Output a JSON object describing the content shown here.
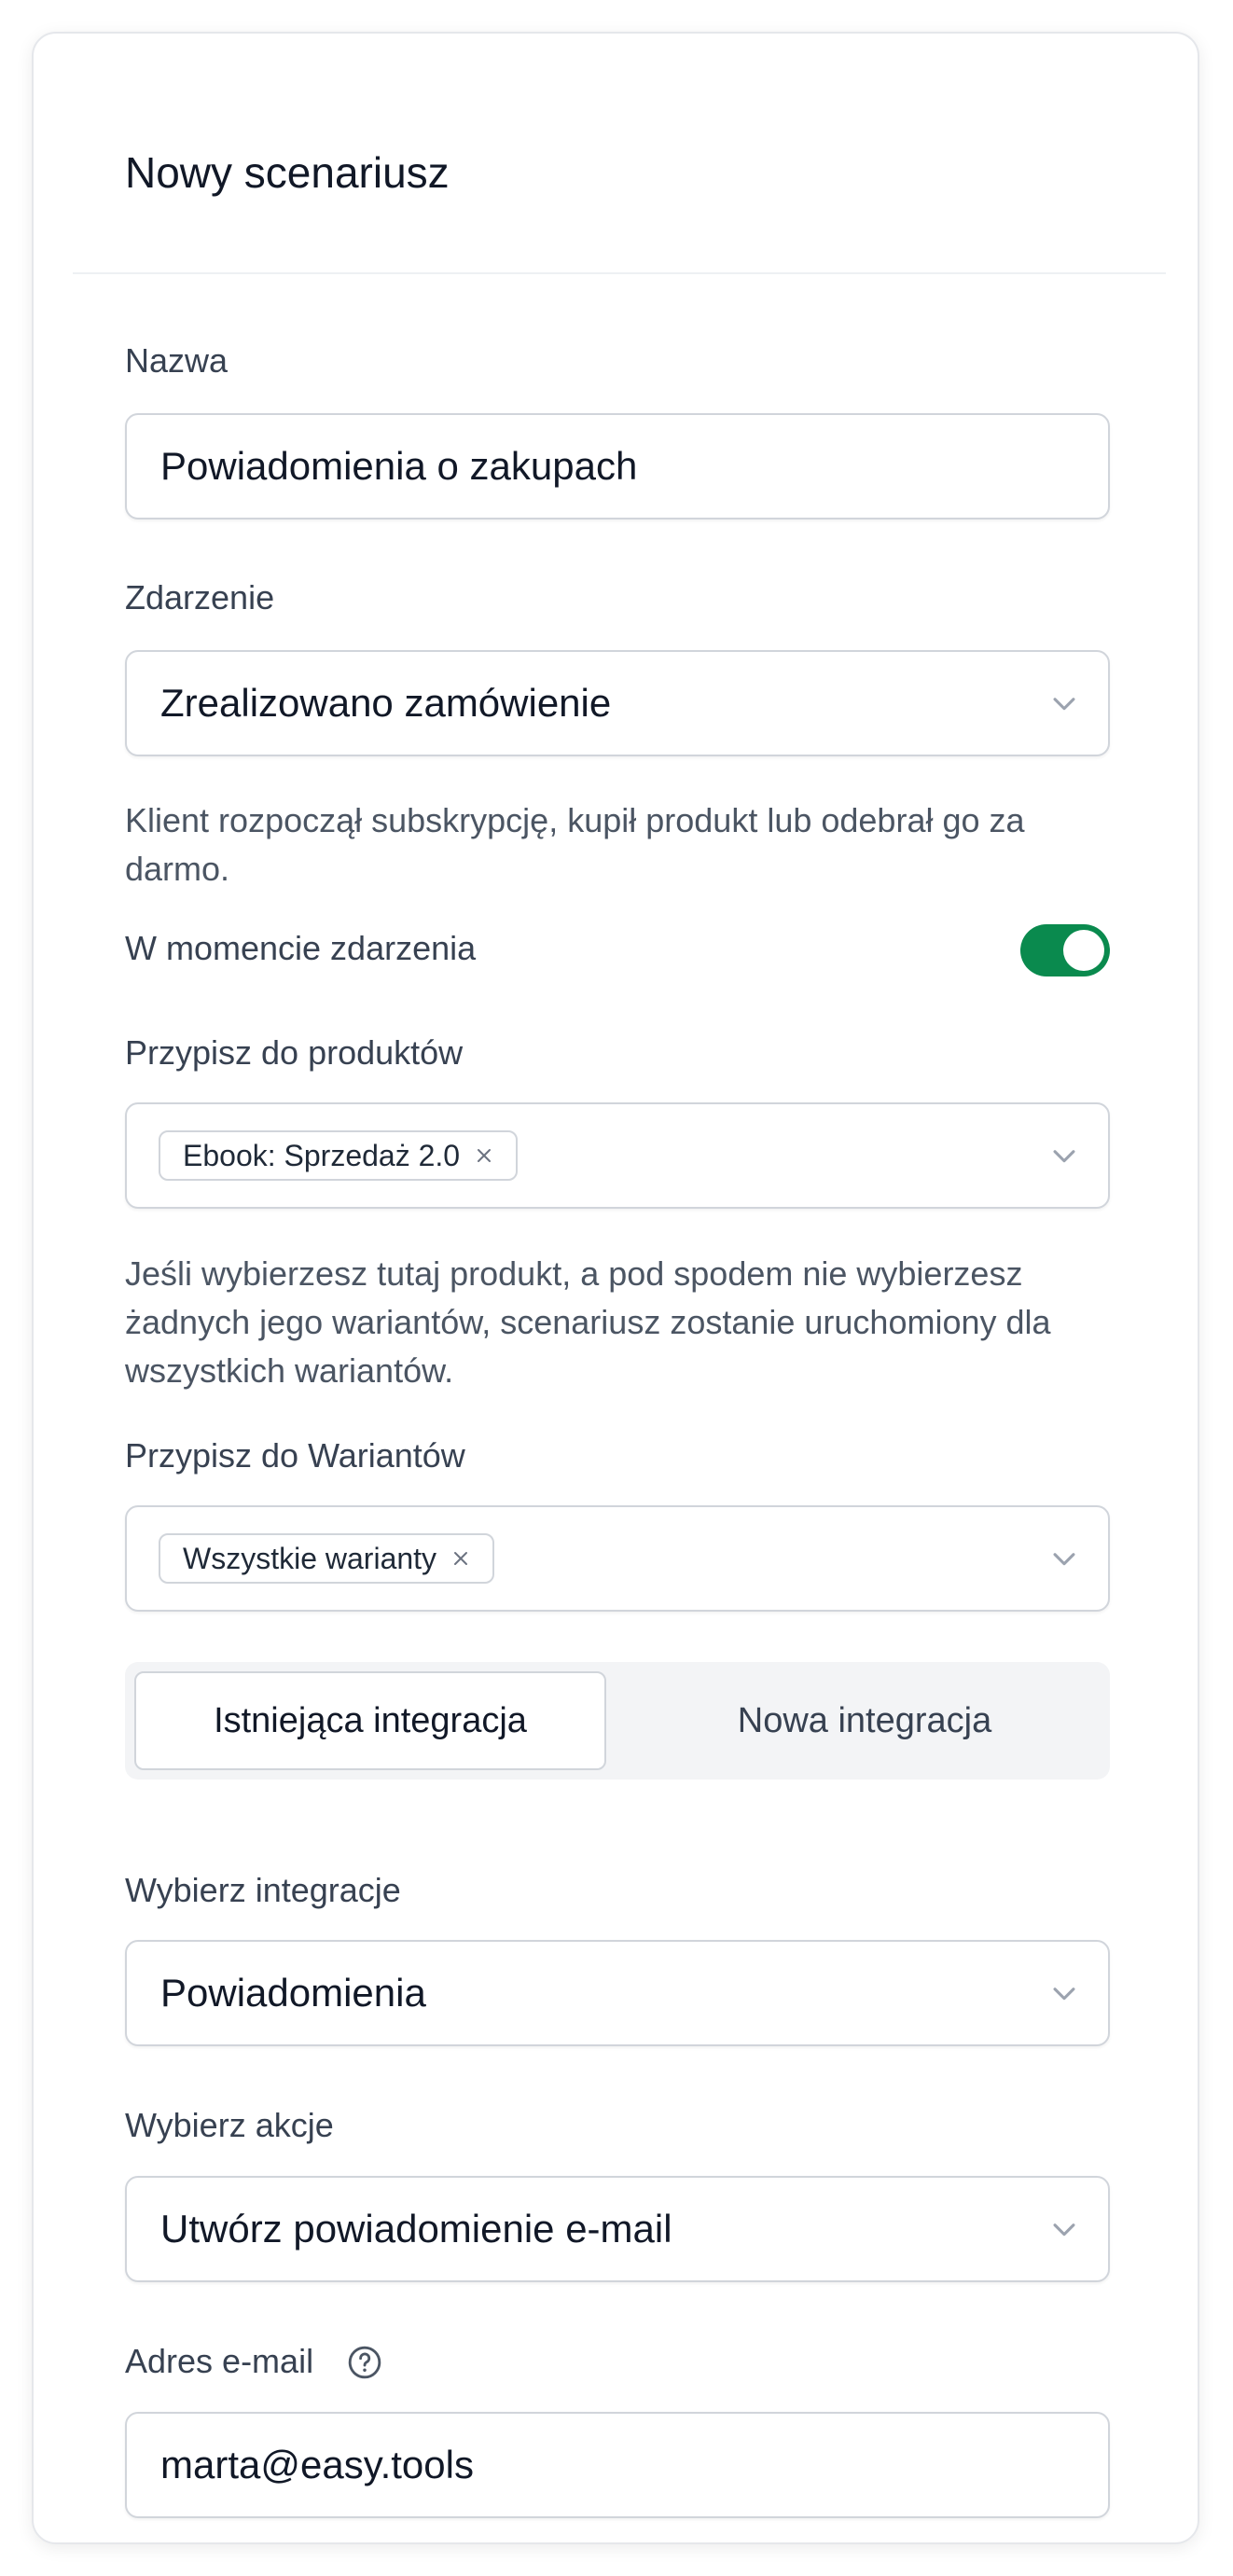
{
  "form": {
    "title": "Nowy scenariusz",
    "name": {
      "label": "Nazwa",
      "value": "Powiadomienia o zakupach"
    },
    "event": {
      "label": "Zdarzenie",
      "value": "Zrealizowano zamówienie",
      "help": "Klient rozpoczął subskrypcję, kupił produkt lub odebrał go za darmo."
    },
    "at_event": {
      "label": "W momencie zdarzenia",
      "enabled": true
    },
    "products": {
      "label": "Przypisz do produktów",
      "chips": [
        "Ebook: Sprzedaż 2.0"
      ],
      "help": "Jeśli wybierzesz tutaj produkt, a pod spodem nie wybierzesz żadnych jego wariantów, scenariusz zostanie uruchomiony dla wszystkich wariantów."
    },
    "variants": {
      "label": "Przypisz do Wariantów",
      "chips": [
        "Wszystkie warianty"
      ]
    },
    "integration_tabs": {
      "existing": "Istniejąca integracja",
      "new": "Nowa integracja",
      "active": "existing"
    },
    "integration": {
      "label": "Wybierz integracje",
      "value": "Powiadomienia"
    },
    "action": {
      "label": "Wybierz akcje",
      "value": "Utwórz powiadomienie e-mail"
    },
    "email": {
      "label": "Adres e-mail",
      "value": "marta@easy.tools"
    }
  },
  "colors": {
    "toggle_on": "#0a8a4e",
    "border": "#d1d5db",
    "tab_bg": "#f3f4f6"
  },
  "icons": {
    "chevron": "chevron-down-icon",
    "chip_remove": "close-icon",
    "help": "question-circle-icon"
  }
}
